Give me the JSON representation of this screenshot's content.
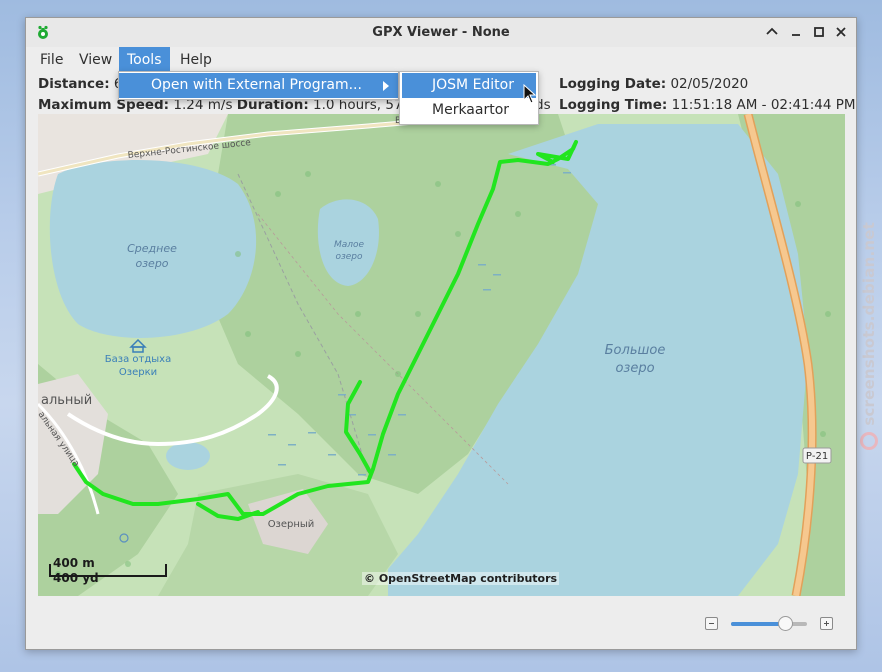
{
  "watermark": {
    "text": "screenshots.debian.net"
  },
  "window": {
    "title": "GPX Viewer - None"
  },
  "menubar": {
    "file": "File",
    "view": "View",
    "tools": "Tools",
    "help": "Help",
    "active": "Tools"
  },
  "tools_menu": {
    "items": [
      {
        "label": "Open with External Program...",
        "has_submenu": true
      }
    ],
    "submenu": [
      {
        "label": "JOSM Editor",
        "highlighted": true
      },
      {
        "label": "Merkaartor"
      }
    ]
  },
  "stats": {
    "distance_label": "Distance:",
    "distance_value": "6",
    "max_speed_label": "Maximum Speed:",
    "max_speed_value": "1.24 m/s",
    "duration_label": "Duration:",
    "duration_value": "1.0 hours, 57.0",
    "duration_tail": "ds",
    "logging_date_label": "Logging Date:",
    "logging_date_value": "02/05/2020",
    "logging_time_label": "Logging Time:",
    "logging_time_value": "11:51:18 AM - 02:41:44 PM"
  },
  "map": {
    "labels": {
      "highway": "Верхне-Ростинское шоссе",
      "lake_sredneye_1": "Среднее",
      "lake_sredneye_2": "озеро",
      "lake_maloye_1": "Малое",
      "lake_maloye_2": "озеро",
      "lake_bolshoye_1": "Большое",
      "lake_bolshoye_2": "озеро",
      "camp_1": "База отдыха",
      "camp_2": "Озерки",
      "district": "альный",
      "street": "альная улица",
      "village": "Озерный",
      "road_badge": "Р-21",
      "top_fragment": "Ва"
    },
    "scale": {
      "metric": "400 m",
      "imperial": "400 yd"
    },
    "attribution": "© OpenStreetMap contributors",
    "colors": {
      "track": "#22e51f",
      "water": "#aad3df",
      "forest": "#add19e",
      "grass": "#cde6c0",
      "road": "#f6c88f"
    }
  },
  "zoom": {
    "level_fraction": 0.71
  }
}
